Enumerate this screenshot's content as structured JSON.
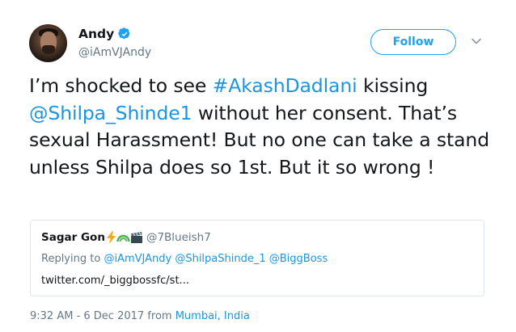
{
  "author": {
    "display_name": "Andy",
    "handle": "@iAmVJAndy",
    "verified": true
  },
  "follow_button": {
    "label": "Follow"
  },
  "tweet": {
    "text_part1": "I’m shocked to see ",
    "hashtag": "#AkashDadlani",
    "text_part2": " kissing ",
    "mention": "@Shilpa_Shinde1",
    "text_part3": " without her consent. That’s sexual Harassment! But no one can take a stand unless Shilpa does so 1st. But it so wrong !"
  },
  "quoted_tweet": {
    "display_name": "Sagar Gon",
    "handle": "@7Blueish7",
    "replying_prefix": "Replying to ",
    "replying_to": [
      "@iAmVJAndy",
      "@ShilpaShinde_1",
      "@BiggBoss"
    ],
    "url_text": "twitter.com/_biggbossfc/st..."
  },
  "meta": {
    "timestamp": "9:32 AM - 6 Dec 2017",
    "from_prefix": " from ",
    "location": "Mumbai, India"
  },
  "colors": {
    "link": "#1b95e0",
    "verified": "#1da1f2",
    "secondary_text": "#657786",
    "border": "#e1e8ed"
  },
  "icons": {
    "verified": "verified-badge-icon",
    "chevron": "chevron-down-icon",
    "emoji": [
      "lightning-emoji",
      "rainbow-emoji",
      "clapperboard-emoji"
    ]
  }
}
